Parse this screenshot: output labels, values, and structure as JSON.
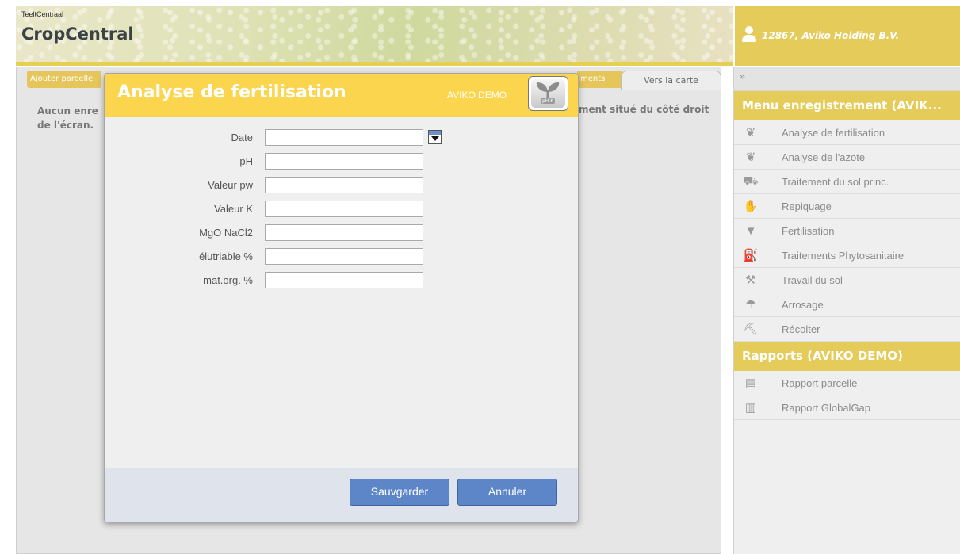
{
  "header": {
    "brand_small": "TeeltCentraal",
    "brand_big": "CropCentral",
    "user": "12867, Aviko Holding B.V."
  },
  "main": {
    "add_tab": "Ajouter parcelle",
    "partial_tab": "ments",
    "map_tab": "Vers la carte",
    "message_left_1": "Aucun enre",
    "message_left_2": "de l'écran.",
    "message_right": "ment situé du côté droit"
  },
  "sidebar": {
    "collapse": "»",
    "menu_title": "Menu enregistrement (AVIK...",
    "menu_items": [
      {
        "label": "Analyse de fertilisation",
        "icon": "plant-icon"
      },
      {
        "label": "Analyse de l'azote",
        "icon": "plant-icon"
      },
      {
        "label": "Traitement du sol princ.",
        "icon": "tractor-icon"
      },
      {
        "label": "Repiquage",
        "icon": "planting-icon"
      },
      {
        "label": "Fertilisation",
        "icon": "fertilizer-icon"
      },
      {
        "label": "Traitements Phytosanitaire",
        "icon": "sprayer-icon"
      },
      {
        "label": "Travail du sol",
        "icon": "cultivator-icon"
      },
      {
        "label": "Arrosage",
        "icon": "irrigation-icon"
      },
      {
        "label": "Récolter",
        "icon": "harvester-icon"
      }
    ],
    "reports_title": "Rapports (AVIKO DEMO)",
    "report_items": [
      {
        "label": "Rapport parcelle",
        "icon": "clipboard-icon"
      },
      {
        "label": "Rapport GlobalGap",
        "icon": "clipboard-g-icon"
      }
    ]
  },
  "modal": {
    "title": "Analyse de fertilisation",
    "org": "AVIKO DEMO",
    "logo_text": "pH K",
    "fields": [
      {
        "label": "Date",
        "value": ""
      },
      {
        "label": "pH",
        "value": ""
      },
      {
        "label": "Valeur pw",
        "value": ""
      },
      {
        "label": "Valeur K",
        "value": ""
      },
      {
        "label": "MgO NaCl2",
        "value": ""
      },
      {
        "label": "élutriable %",
        "value": ""
      },
      {
        "label": "mat.org. %",
        "value": ""
      }
    ],
    "save_label": "Sauvgarder",
    "cancel_label": "Annuler"
  },
  "colors": {
    "accent_yellow": "#e5cb59",
    "modal_header": "#fbd54d",
    "button_blue": "#5d86c9"
  }
}
